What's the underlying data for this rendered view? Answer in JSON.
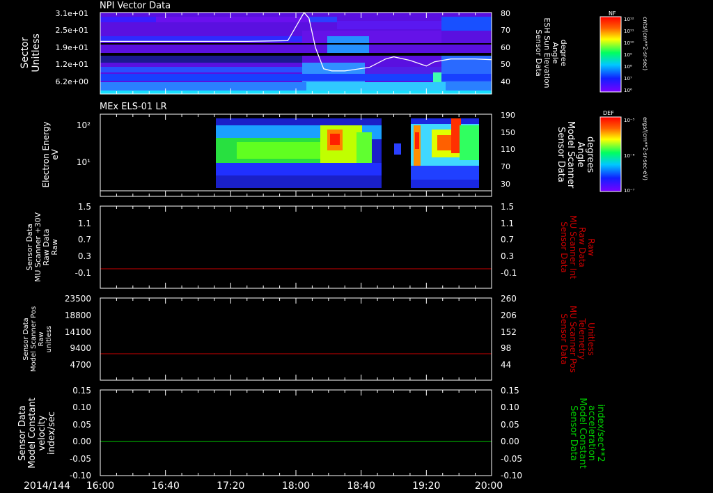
{
  "date_label": "2014/144",
  "time_axis": {
    "start": "16:00",
    "end": "20:00",
    "tick_labels": [
      "16:00",
      "16:40",
      "17:20",
      "18:00",
      "18:40",
      "19:20",
      "20:00"
    ]
  },
  "colors": {
    "red_trace": "#cc0000",
    "green_trace": "#00cc00",
    "white": "#ffffff"
  },
  "colorbars": [
    {
      "label": "NF",
      "units": "cnts/(cm**2-sr-sec)",
      "tick_labels": [
        "10¹²",
        "10¹¹",
        "10¹⁰",
        "10⁹",
        "10⁸",
        "10⁷",
        "10⁶"
      ]
    },
    {
      "label": "DEF",
      "units": "ergs/(cm**2-sr-sec-eV)",
      "tick_labels": [
        "10⁻⁵",
        "10⁻⁶",
        "10⁻⁷"
      ]
    }
  ],
  "chart_data": [
    {
      "type": "heatmap",
      "title": "NPI Vector Data",
      "ylabel": [
        "Sector",
        "Unitless"
      ],
      "ytick_labels": [
        "3.1e+01",
        "2.5e+01",
        "1.9e+01",
        "1.2e+01",
        "6.2e+00"
      ],
      "y2label": [
        "Sensor Data",
        "ESH Sun Elevation",
        "Angle",
        "degree"
      ],
      "y2tick_labels": [
        "80",
        "70",
        "60",
        "50",
        "40"
      ],
      "y2lim": [
        30,
        80
      ],
      "overlay_line": {
        "name": "ESH Sun Elevation Angle",
        "x": [
          "16:00",
          "17:30",
          "17:55",
          "18:00",
          "18:05",
          "18:08",
          "18:12",
          "18:17",
          "18:22",
          "18:30",
          "18:45",
          "18:55",
          "19:00",
          "19:10",
          "19:20",
          "19:25",
          "19:35",
          "19:50",
          "20:00"
        ],
        "y": [
          59.5,
          59.5,
          60,
          70,
          80,
          76,
          55,
          40,
          38.5,
          38.5,
          41,
          47,
          48.5,
          46,
          42,
          45,
          47,
          47,
          46.5
        ]
      }
    },
    {
      "type": "heatmap",
      "title": "MEx ELS-01 LR",
      "ylabel": [
        "Electron Energy",
        "eV"
      ],
      "ytick_labels": [
        "10²",
        "10¹"
      ],
      "ylog": true,
      "y2label": [
        "Sensor Data",
        "Model Scanner",
        "Angle",
        "degrees"
      ],
      "y2tick_labels": [
        "190",
        "150",
        "110",
        "70",
        "30"
      ],
      "y2lim": [
        0,
        190
      ],
      "overlay_line": {
        "x": [
          "16:00",
          "20:00"
        ],
        "y": [
          10,
          10
        ]
      }
    },
    {
      "type": "line",
      "ylabel": [
        "Sensor Data",
        "MU Scanner +30V",
        "Raw Data",
        "Raw"
      ],
      "ytick_labels": [
        "1.5",
        "1.1",
        "0.7",
        "0.3",
        "-0.1"
      ],
      "y2label": [
        "Sensor Data",
        "MU Scanner Int",
        "Raw Data",
        "Raw"
      ],
      "y2tick_labels": [
        "1.5",
        "1.1",
        "0.7",
        "0.3",
        "-0.1"
      ],
      "ylim": [
        -0.5,
        1.5
      ],
      "series": [
        {
          "x": [
            "16:00",
            "20:00"
          ],
          "y": [
            0,
            0
          ]
        }
      ]
    },
    {
      "type": "line",
      "ylabel": [
        "Sensor Data",
        "Model Scanner Pos",
        "Raw",
        "unitless"
      ],
      "ytick_labels": [
        "23500",
        "18800",
        "14100",
        "9400",
        "4700"
      ],
      "y2label": [
        "Sensor Data",
        "MU Scanner Pos",
        "Telemetry",
        "Unitless"
      ],
      "y2tick_labels": [
        "260",
        "206",
        "152",
        "98",
        "44"
      ],
      "ylim": [
        0,
        23500
      ],
      "series": [
        {
          "x": [
            "16:00",
            "20:00"
          ],
          "y": [
            7800,
            7800
          ]
        }
      ]
    },
    {
      "type": "line",
      "ylabel": [
        "Sensor Data",
        "Model Constant",
        "velocity",
        "index/sec"
      ],
      "ytick_labels": [
        "0.15",
        "0.10",
        "0.05",
        "0.00",
        "-0.05",
        "-0.10"
      ],
      "y2label": [
        "Sensor Data",
        "Model Constant",
        "acceleration",
        "index/sec**2"
      ],
      "y2tick_labels": [
        "0.15",
        "0.10",
        "0.05",
        "0.00",
        "-0.05",
        "-0.10"
      ],
      "ylim": [
        -0.1,
        0.15
      ],
      "series": [
        {
          "x": [
            "16:00",
            "20:00"
          ],
          "y": [
            0,
            0
          ]
        }
      ]
    }
  ]
}
